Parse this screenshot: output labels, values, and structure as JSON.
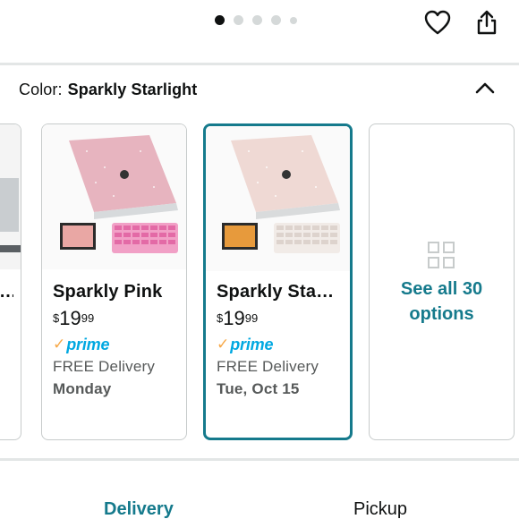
{
  "carousel": {
    "dot_count": 5,
    "active_index": 0
  },
  "icons": {
    "heart": "heart-icon",
    "share": "share-icon",
    "collapse": "chevron-up-icon",
    "grid": "grid-icon"
  },
  "colors": {
    "accent": "#157a8c",
    "prime_blue": "#00a8e1",
    "prime_check": "#f7a847",
    "muted_text": "#565959"
  },
  "color_selector": {
    "label": "Color:",
    "value": "Sparkly Starlight"
  },
  "options": [
    {
      "name": "…",
      "price_symbol": "",
      "price_whole": "",
      "price_fraction": "",
      "prime": "",
      "delivery": "",
      "date": ""
    },
    {
      "name": "Sparkly Pink",
      "price_symbol": "$",
      "price_whole": "19",
      "price_fraction": "99",
      "prime": "prime",
      "delivery": "FREE Delivery",
      "date": "Monday",
      "selected": false
    },
    {
      "name": "Sparkly Sta…",
      "price_symbol": "$",
      "price_whole": "19",
      "price_fraction": "99",
      "prime": "prime",
      "delivery": "FREE Delivery",
      "date": "Tue, Oct 15",
      "selected": true
    }
  ],
  "see_all": {
    "line1": "See all 30",
    "line2": "options"
  },
  "tabs": {
    "delivery": "Delivery",
    "pickup": "Pickup"
  }
}
